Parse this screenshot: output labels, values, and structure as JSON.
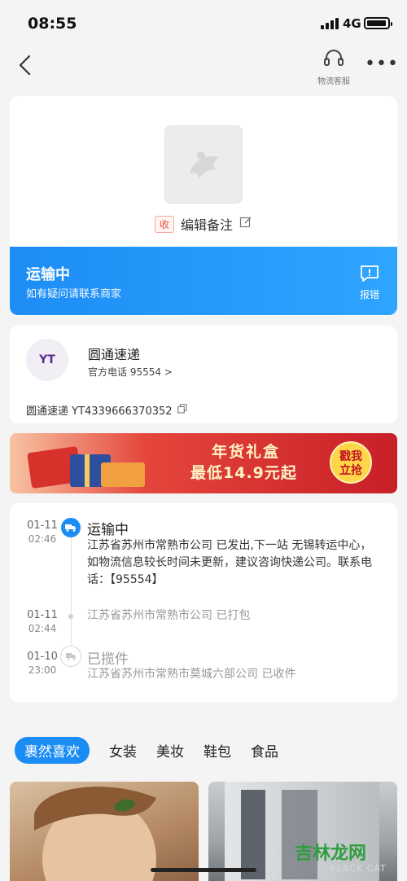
{
  "status_bar": {
    "time": "08:55",
    "network": "4G",
    "battery_level": 0.95
  },
  "nav": {
    "service_label": "物流客服",
    "more_label": "•••"
  },
  "package": {
    "tag": "收",
    "note_label": "编辑备注"
  },
  "transit": {
    "title": "运输中",
    "subtitle": "如有疑问请联系商家",
    "report_label": "报错",
    "colors": {
      "accent": "#1d8df5"
    }
  },
  "courier": {
    "logo_text": "YT",
    "name": "圆通速递",
    "phone_label": "官方电话 95554 >",
    "tracking": "圆通速递 YT4339666370352"
  },
  "banner": {
    "line1": "年货礼盒",
    "line2": "最低14.9元起",
    "button_line1": "戳我",
    "button_line2": "立抢"
  },
  "timeline": [
    {
      "date": "01-11",
      "time": "02:46",
      "title": "运输中",
      "body": "江苏省苏州市常熟市公司 已发出,下一站 无锡转运中心，如物流信息较长时间未更新，建议咨询快递公司。联系电话：【95554】"
    },
    {
      "date": "01-11",
      "time": "02:44",
      "title": "",
      "body": "江苏省苏州市常熟市公司 已打包"
    },
    {
      "date": "01-10",
      "time": "23:00",
      "title": "已揽件",
      "body": "江苏省苏州市常熟市莫城六部公司 已收件"
    }
  ],
  "categories": [
    "裹然喜欢",
    "女装",
    "美妆",
    "鞋包",
    "食品"
  ],
  "watermark": {
    "text": "吉林龙网",
    "sub": "BLACK CAT"
  }
}
